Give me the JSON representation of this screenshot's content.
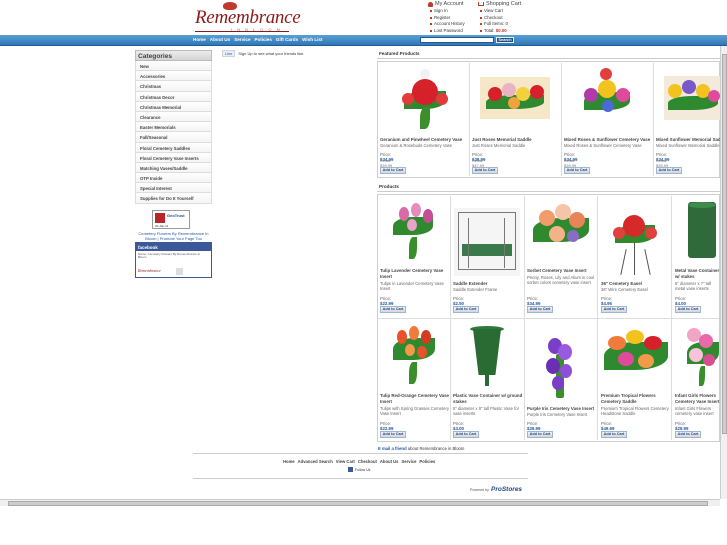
{
  "logo": {
    "text": "Remembrance",
    "sub": "I N   B L O O M"
  },
  "account": {
    "title": "My Account",
    "items": [
      "Sign In",
      "Register",
      "Account History",
      "Lost Password"
    ]
  },
  "cart": {
    "title": "Shopping Cart",
    "items": [
      "View Cart",
      "Checkout",
      "Full Items: 0"
    ],
    "total_label": "Total:",
    "total_value": "$0.00"
  },
  "nav": [
    "Home",
    "About Us",
    "Service",
    "Policies",
    "Gift Cards",
    "Wish List"
  ],
  "search": {
    "button": "Search",
    "value": ""
  },
  "like": {
    "button": "Like",
    "text": "Sign Up to see what your friends like."
  },
  "sidebar": {
    "title": "Categories",
    "items": [
      "New",
      "Accessories",
      "Christmas",
      "Christmas Decor",
      "Christmas Memorial",
      "Clearance",
      "Easter Memorials",
      "Fall/Seasonal",
      "Floral Cemetery Saddles",
      "Floral Cemetery Vase Inserts",
      "Matching Vases/Saddle",
      "OTP Inside",
      "Special Interest",
      "Supplies for Do It Yourself"
    ],
    "geotrust": {
      "brand": "GeoTrust",
      "note": "20-Jan-11"
    },
    "link": "Cemetery Flowers By Remembrance In Bloom | Promote Your Page Too",
    "fb_title": "facebook",
    "fb_text": "Name: Cemetary Flowers By Remembrance In Bloom",
    "fb_logo": "Remembrance",
    "fb_other": "Pages"
  },
  "featured": {
    "title": "Featured Products",
    "items": [
      {
        "name": "Geranium and Pinwheel Cemetery Vase",
        "desc": "Geranium & Rosebuds Cemetery Vase",
        "price": "$34.99",
        "retail": "$39.99"
      },
      {
        "name": "Just Roses Memorial Saddle",
        "desc": "Just Roses Memorial Saddle",
        "price": "$39.99",
        "retail": "$47.99"
      },
      {
        "name": "Mixed Roses & Sunflower Cemetery Vase",
        "desc": "Mixed Roses & Sunflower Cemetery Vase",
        "price": "$34.99",
        "retail": "$39.99"
      },
      {
        "name": "Mixed Sunflower Memorial Saddle",
        "desc": "Mixed Sunflower Memorial Saddle",
        "price": "$34.99",
        "retail": "$39.99"
      }
    ]
  },
  "products": {
    "title": "Products",
    "row1": [
      {
        "name": "Tulip Lavender Cemetery Vase Insert",
        "desc": "Tulips in Lavender Cemetery Vase Insert",
        "price": "$22.99"
      },
      {
        "name": "Saddle Extender",
        "desc": "Saddle Extender Frame",
        "price": "$2.50"
      },
      {
        "name": "Sorbet Cemetery Vase Insert",
        "desc": "Peony, Roses, Lily and Alium in cool sorbet colors cemetery vase insert",
        "price": "$34.99"
      },
      {
        "name": "36\" Cemetery Easel",
        "desc": "36\" Wire Cemetery Easel",
        "price": "$4.95"
      },
      {
        "name": "Metal Vase Container w/ stakes",
        "desc": "6\" diameter x 7\" tall metal vase inserts",
        "price": "$4.00"
      }
    ],
    "row2": [
      {
        "name": "Tulip Red-Orange Cemetery Vase Insert",
        "desc": "Tulips with Spring Grasses Cemetery Vase Insert",
        "price": "$22.99"
      },
      {
        "name": "Plastic Vase Container w/ ground stakes",
        "desc": "5\" diameter x 9\" tall Plastic Vase for vase inserts",
        "price": "$3.00"
      },
      {
        "name": "Purple Iris Cemetery Vase Insert",
        "desc": "Purple Iris Cemetery Vase Insert",
        "price": "$29.99"
      },
      {
        "name": "Premium Tropical Flowers Cemetery Saddle",
        "desc": "Premium Tropical Flowers Cemetery Headstone Saddle",
        "price": "$49.99"
      },
      {
        "name": "Infant Girls Flowers Cemetery Vase Insert",
        "desc": "Infant Girls Flowers cemetery vase insert",
        "price": "$29.99"
      }
    ]
  },
  "labels": {
    "price": "Price:",
    "retail": "Retail:",
    "add": "Add to Cart"
  },
  "email_friend": {
    "link": "E mail a friend",
    "text": "about Remembrance in Bloom"
  },
  "footer": {
    "links": [
      "Home",
      "Advanced Search",
      "View Cart",
      "Checkout",
      "About Us",
      "Service",
      "Policies"
    ],
    "follow": "Follow Us",
    "powered": "Powered by",
    "brand": "ProStores"
  }
}
